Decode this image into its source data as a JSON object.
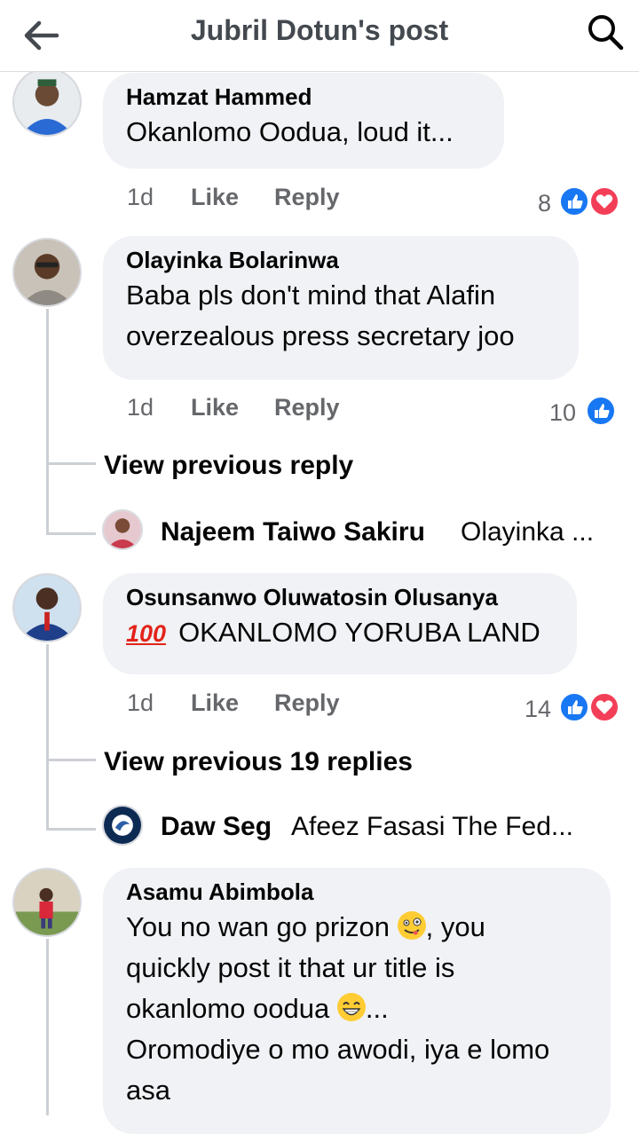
{
  "header": {
    "title": "Jubril Dotun's post"
  },
  "comments": [
    {
      "author": "Hamzat Hammed",
      "text": "Okanlomo Oodua, loud it...",
      "time": "1d",
      "like_label": "Like",
      "reply_label": "Reply",
      "reactions": "8"
    },
    {
      "author": "Olayinka Bolarinwa",
      "line1": "Baba pls don't mind that Alafin",
      "line2": "overzealous press secretary joo",
      "time": "1d",
      "like_label": "Like",
      "reply_label": "Reply",
      "reactions": "10",
      "view_previous": "View previous reply",
      "reply": {
        "author": "Najeem Taiwo Sakiru",
        "text": "Olayinka ..."
      }
    },
    {
      "author": "Osunsanwo Oluwatosin Olusanya",
      "badge": "100",
      "text": "OKANLOMO YORUBA LAND",
      "time": "1d",
      "like_label": "Like",
      "reply_label": "Reply",
      "reactions": "14",
      "view_previous": "View previous 19 replies",
      "reply": {
        "author": "Daw Seg",
        "text": "Afeez Fasasi The Fed..."
      }
    },
    {
      "author": "Asamu Abimbola",
      "line1": "You no wan go prizon",
      "line1b": ", you",
      "line2": "quickly post it that ur title is",
      "line3": "okanlomo oodua",
      "line3b": "...",
      "line4": "Oromodiye o mo awodi, iya e lomo",
      "line5": "asa"
    }
  ],
  "colors": {
    "like": "#1877f2",
    "love": "#f33e58",
    "bubble": "#f0f2f5",
    "meta": "#65676b"
  }
}
